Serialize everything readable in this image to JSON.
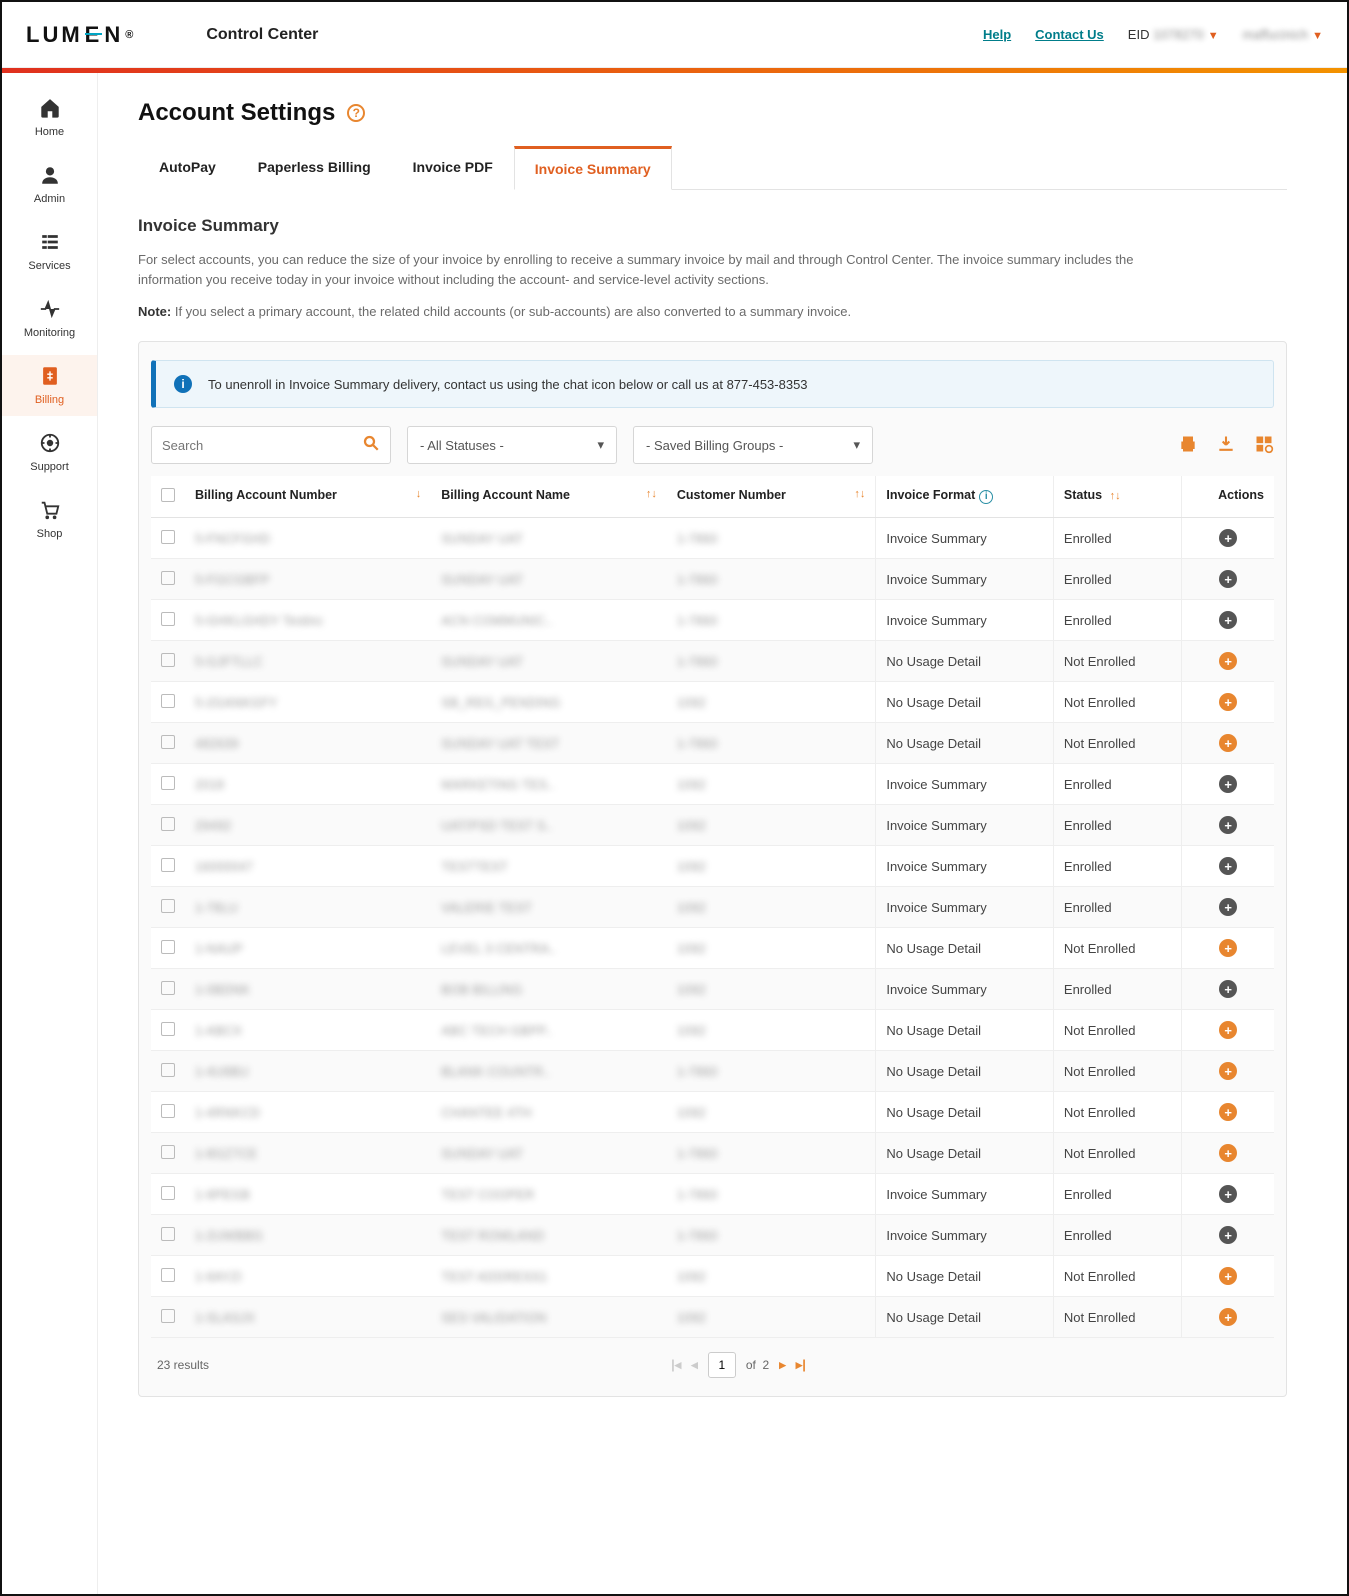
{
  "brand": "LUMEN",
  "app_name": "Control Center",
  "top_links": {
    "help": "Help",
    "contact": "Contact Us"
  },
  "eid_prefix": "EID",
  "eid_value": "1078270",
  "user_name": "maffucinich",
  "sidebar": [
    {
      "key": "home",
      "label": "Home"
    },
    {
      "key": "admin",
      "label": "Admin"
    },
    {
      "key": "services",
      "label": "Services"
    },
    {
      "key": "monitoring",
      "label": "Monitoring"
    },
    {
      "key": "billing",
      "label": "Billing",
      "active": true
    },
    {
      "key": "support",
      "label": "Support"
    },
    {
      "key": "shop",
      "label": "Shop"
    }
  ],
  "page_title": "Account Settings",
  "tabs": [
    {
      "key": "autopay",
      "label": "AutoPay"
    },
    {
      "key": "paperless",
      "label": "Paperless Billing"
    },
    {
      "key": "invoicepdf",
      "label": "Invoice PDF"
    },
    {
      "key": "summary",
      "label": "Invoice Summary",
      "active": true
    }
  ],
  "section_title": "Invoice Summary",
  "description": "For select accounts, you can reduce the size of your invoice by enrolling to receive a summary invoice by mail and through Control Center. The invoice summary includes the information you receive today in your invoice without including the account- and service-level activity sections.",
  "note_label": "Note:",
  "note_text": " If you select a primary account, the related child accounts (or sub-accounts) are also converted to a summary invoice.",
  "banner": "To unenroll in Invoice Summary delivery, contact us using the chat icon below or call us at 877-453-8353",
  "search_placeholder": "Search",
  "status_select": "- All Statuses -",
  "groups_select": "- Saved Billing Groups -",
  "columns": {
    "ban": "Billing Account Number",
    "name": "Billing Account Name",
    "cust": "Customer Number",
    "format": "Invoice Format",
    "status": "Status",
    "actions": "Actions"
  },
  "rows": [
    {
      "ban": "5-FNCFGHD",
      "name": "SUNDAY UAT",
      "cust": "1-7860",
      "format": "Invoice Summary",
      "status": "Enrolled"
    },
    {
      "ban": "5-FGCGBFP",
      "name": "SUNDAY UAT",
      "cust": "1-7860",
      "format": "Invoice Summary",
      "status": "Enrolled"
    },
    {
      "ban": "5-GHKLGHDY Testinc",
      "name": "ACN COMMUNIC..",
      "cust": "1-7860",
      "format": "Invoice Summary",
      "status": "Enrolled"
    },
    {
      "ban": "5-GJFTLLC",
      "name": "SUNDAY UAT",
      "cust": "1-7860",
      "format": "No Usage Detail",
      "status": "Not Enrolled"
    },
    {
      "ban": "5-2GANKGFY",
      "name": "SB_REG_PENDING",
      "cust": "1092",
      "format": "No Usage Detail",
      "status": "Not Enrolled"
    },
    {
      "ban": "482639",
      "name": "SUNDAY UAT TEST",
      "cust": "1-7860",
      "format": "No Usage Detail",
      "status": "Not Enrolled"
    },
    {
      "ban": "2018",
      "name": "MARKETING TES..",
      "cust": "1092",
      "format": "Invoice Summary",
      "status": "Enrolled"
    },
    {
      "ban": "29492",
      "name": "UAT/PSD TEST S..",
      "cust": "1092",
      "format": "Invoice Summary",
      "status": "Enrolled"
    },
    {
      "ban": "16000047",
      "name": "TESTTEST",
      "cust": "1092",
      "format": "Invoice Summary",
      "status": "Enrolled"
    },
    {
      "ban": "1-78LU",
      "name": "VALERIE TEST",
      "cust": "1092",
      "format": "Invoice Summary",
      "status": "Enrolled"
    },
    {
      "ban": "1-NAUP",
      "name": "LEVEL 3 CENTRA..",
      "cust": "1092",
      "format": "No Usage Detail",
      "status": "Not Enrolled"
    },
    {
      "ban": "1-0BDNK",
      "name": "BOB BILLING",
      "cust": "1092",
      "format": "Invoice Summary",
      "status": "Enrolled"
    },
    {
      "ban": "1-ABCX",
      "name": "ABC TECH GBPP..",
      "cust": "1092",
      "format": "No Usage Detail",
      "status": "Not Enrolled"
    },
    {
      "ban": "1-4U9BU",
      "name": "BLANK COUNTR..",
      "cust": "1-7860",
      "format": "No Usage Detail",
      "status": "Not Enrolled"
    },
    {
      "ban": "1-4RNKCD",
      "name": "CHANTEE 4TH",
      "cust": "1092",
      "format": "No Usage Detail",
      "status": "Not Enrolled"
    },
    {
      "ban": "1-8GZ7CE",
      "name": "SUNDAY UAT",
      "cust": "1-7860",
      "format": "No Usage Detail",
      "status": "Not Enrolled"
    },
    {
      "ban": "1-9PEGB",
      "name": "TEST COOPER",
      "cust": "1-7860",
      "format": "Invoice Summary",
      "status": "Enrolled"
    },
    {
      "ban": "1-2UWBBG",
      "name": "TEST ROWLAND",
      "cust": "1-7860",
      "format": "Invoice Summary",
      "status": "Enrolled"
    },
    {
      "ban": "1-9AYZI",
      "name": "TEST ADDRESS1",
      "cust": "1092",
      "format": "No Usage Detail",
      "status": "Not Enrolled"
    },
    {
      "ban": "1-SLASJX",
      "name": "SES VALIDATION",
      "cust": "1092",
      "format": "No Usage Detail",
      "status": "Not Enrolled"
    }
  ],
  "results_text": "23 results",
  "page_current": "1",
  "page_total": "2",
  "of_text": "of"
}
